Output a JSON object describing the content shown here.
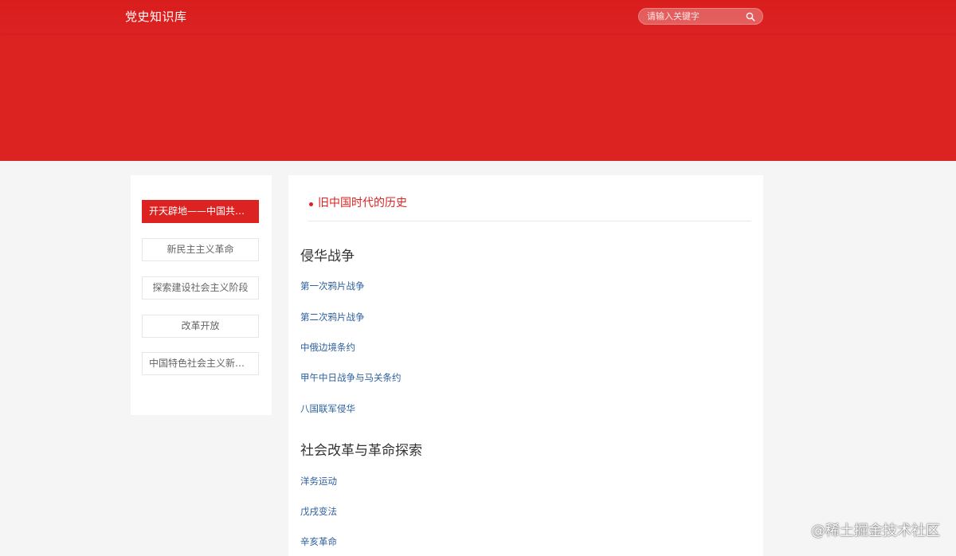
{
  "header": {
    "site_title": "党史知识库",
    "search_placeholder": "请输入关键字",
    "search_icon": "search-icon"
  },
  "colors": {
    "brand_red": "#dd2222",
    "link_blue": "#2c5f9e"
  },
  "sidebar": {
    "items": [
      {
        "label": "开天辟地——中国共产党成立",
        "active": true
      },
      {
        "label": "新民主主义革命",
        "active": false
      },
      {
        "label": "探索建设社会主义阶段",
        "active": false
      },
      {
        "label": "改革开放",
        "active": false
      },
      {
        "label": "中国特色社会主义新时代",
        "active": false
      }
    ]
  },
  "main": {
    "era_title": "旧中国时代的历史",
    "sections": [
      {
        "title": "侵华战争",
        "links": [
          "第一次鸦片战争",
          "第二次鸦片战争",
          "中俄边境条约",
          "甲午中日战争与马关条约",
          "八国联军侵华"
        ]
      },
      {
        "title": "社会改革与革命探索",
        "links": [
          "洋务运动",
          "戊戌变法",
          "辛亥革命"
        ]
      }
    ]
  },
  "watermark": "@稀土掘金技术社区"
}
